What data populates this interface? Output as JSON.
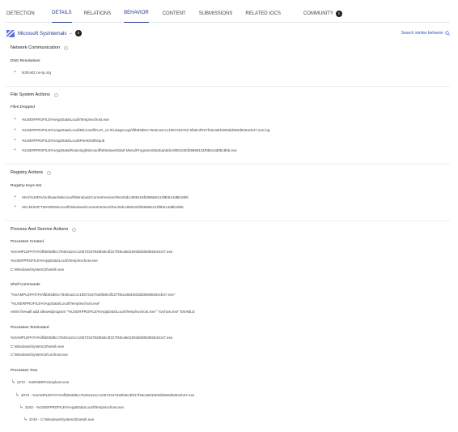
{
  "tabs": [
    {
      "label": "DETECTION"
    },
    {
      "label": "DETAILS"
    },
    {
      "label": "RELATIONS"
    },
    {
      "label": "BEHAVIOR"
    },
    {
      "label": "CONTENT"
    },
    {
      "label": "SUBMISSIONS"
    },
    {
      "label": "RELATED IOCS"
    },
    {
      "label": "COMMUNITY",
      "badge": "1"
    }
  ],
  "sandbox": {
    "name": "Microsoft Sysinternals",
    "count": "2",
    "search_label": "Search similar behavior"
  },
  "network": {
    "title": "Network Communication",
    "dns_title": "DNS Resolutions",
    "dns": [
      "ts3host1.no-ip.org"
    ]
  },
  "filesystem": {
    "title": "File System Actions",
    "dropped_title": "Files Dropped",
    "dropped": [
      "%USERPROFILE%\\AppData\\Local\\Temp\\svchost.exe",
      "%USERPROFILE%\\AppData\\Local\\Microsoft\\CLR_v4.0\\UsageLogs\\fbb93d8cc7640ca2ccc1067234762 6fa9c3f227f46ca9d1903dd360d9264cb47.exe.log",
      "%USERPROFILE%\\AppData\\Local\\PeerDistRepub",
      "%USERPROFILE%\\AppData\\Roaming\\Microsoft\\Windows\\Start Menu\\Programs\\Startup\\0dcc806104fd39668131f9b614d8b18b5.exe"
    ]
  },
  "registry": {
    "title": "Registry Actions",
    "set_title": "Registry Keys Set",
    "keys": [
      "HKU\\%SID%\\Software\\Microsoft\\Windows\\CurrentVersion\\Run\\0dcc806104fd39668131f9b614d8b18b5",
      "HKLM\\SOFTWARE\\Microsoft\\Windows\\CurrentVersion\\Run\\0dcc806104fd39668131f9b614d8b18b5"
    ]
  },
  "process": {
    "title": "Process And Service Actions",
    "created_title": "Processes Created",
    "created": [
      "%SAMPLEPATH%\\fbb93d8cc7640ca2ccc10672347626fa9c3f227f46ca9d1903dd360d9264cb47.exe",
      "%USERPROFILE%\\AppData\\Local\\Temp\\svchost.exe",
      "C:\\Windows\\System32\\netsh.exe"
    ],
    "shell_title": "Shell Commands",
    "shell": [
      "\"%SAMPLEPATH%\\fbb93d8cc7640ca2ccc10672347626fa9c3f227f46ca9d1903dd360d9264cb47.exe\"",
      "\"%USERPROFILE%\\AppData\\Local\\Temp\\svchost.exe\"",
      "netsh firewall add allowedprogram \"%USERPROFILE%\\AppData\\Local\\Temp\\svchost.exe\" \"svchost.exe\" ENABLE"
    ],
    "terminated_title": "Processes Terminated",
    "terminated": [
      "%SAMPLEPATH%\\fbb93d8cc7640ca2ccc10672347626fa9c3f227f46ca9d1903dd360d9264cb47.exe",
      "C:\\Windows\\System32\\netsh.exe",
      "C:\\Windows\\System32\\conhost.exe"
    ],
    "tree_title": "Processes Tree",
    "tree": [
      "2272 - %WINDIR%\\explorer.exe",
      "2076 - %SAMPLEPATH%\\fbb93d8cc7640ca2ccc10672347626fa9c3f227f46ca9d1903dd360d9264cb47.exe",
      "3192 - %USERPROFILE%\\AppData\\Local\\Temp\\svchost.exe",
      "3740 - C:\\Windows\\System32\\netsh.exe"
    ]
  },
  "colors": {
    "accent": "#1f3a93",
    "link": "#2456c8"
  }
}
